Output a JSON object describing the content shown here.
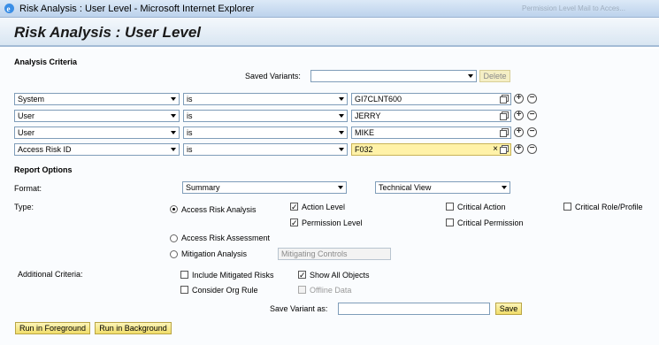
{
  "window": {
    "title": "Risk Analysis : User Level - Microsoft Internet Explorer",
    "right_text": "Permission Level Mail to Acces..."
  },
  "page": {
    "title": "Risk Analysis : User Level"
  },
  "analysis": {
    "heading": "Analysis Criteria",
    "saved_variants_label": "Saved Variants:",
    "saved_variants_value": "",
    "delete_label": "Delete",
    "rows": [
      {
        "field": "System",
        "operator": "is",
        "value": "GI7CLNT600"
      },
      {
        "field": "User",
        "operator": "is",
        "value": "JERRY"
      },
      {
        "field": "User",
        "operator": "is",
        "value": "MIKE"
      },
      {
        "field": "Access Risk ID",
        "operator": "is",
        "value": "F032"
      }
    ]
  },
  "report": {
    "heading": "Report Options",
    "format_label": "Format:",
    "format_value": "Summary",
    "view_value": "Technical View",
    "type_label": "Type:",
    "types": {
      "access_risk_analysis": "Access Risk Analysis",
      "access_risk_assessment": "Access Risk Assessment",
      "mitigation_analysis": "Mitigation Analysis"
    },
    "selected_type": "Access Risk Analysis",
    "mitigating_placeholder": "Mitigating Controls",
    "checks": {
      "action_level": {
        "label": "Action Level",
        "checked": true
      },
      "permission_level": {
        "label": "Permission Level",
        "checked": true
      },
      "critical_action": {
        "label": "Critical Action",
        "checked": false
      },
      "critical_permission": {
        "label": "Critical Permission",
        "checked": false
      },
      "critical_role_profile": {
        "label": "Critical Role/Profile",
        "checked": false
      }
    }
  },
  "additional": {
    "label": "Additional Criteria:",
    "include_mitigated": {
      "label": "Include Mitigated Risks",
      "checked": false
    },
    "show_all_objects": {
      "label": "Show All Objects",
      "checked": true
    },
    "consider_org_rule": {
      "label": "Consider Org Rule",
      "checked": false
    },
    "offline_data": {
      "label": "Offline Data",
      "checked": false
    }
  },
  "save_variant": {
    "label": "Save Variant as:",
    "value": "",
    "button": "Save"
  },
  "actions": {
    "run_foreground": "Run in Foreground",
    "run_background": "Run in Background"
  },
  "colors": {
    "button_yellow": "#f1dd6a",
    "highlight_field": "#fff2a8",
    "header_blue": "#d9e6f2"
  }
}
